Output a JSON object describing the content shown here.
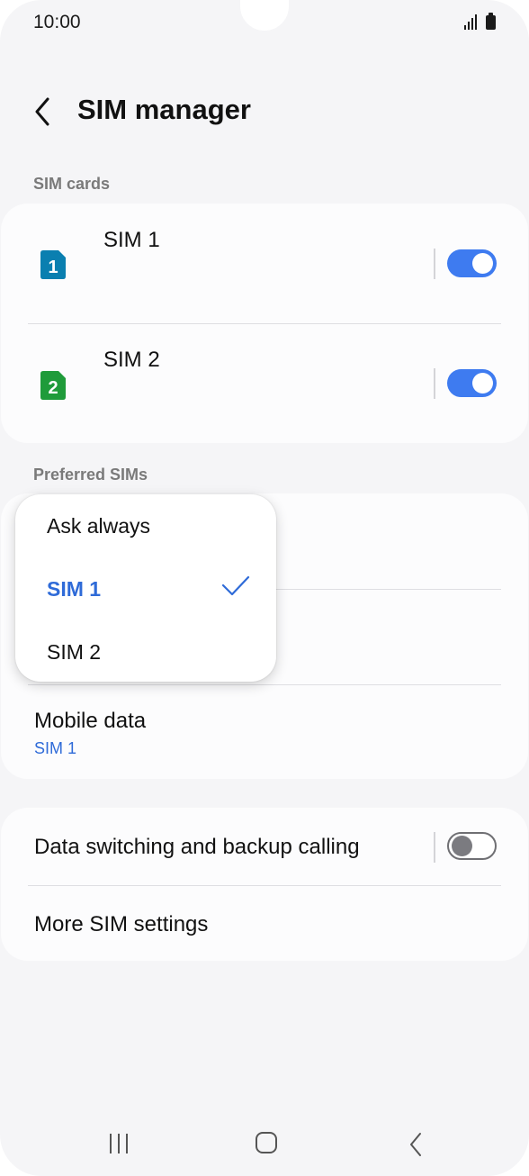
{
  "status_bar": {
    "time": "10:00",
    "icons": [
      "signal-icon",
      "battery-icon"
    ]
  },
  "header": {
    "back_icon": "chevron-left-icon",
    "title": "SIM manager"
  },
  "sim_cards": {
    "section_label": "SIM cards",
    "items": [
      {
        "label": "SIM 1",
        "badge": "1",
        "color": "#0a7fb0",
        "enabled": true
      },
      {
        "label": "SIM 2",
        "badge": "2",
        "color": "#1f9b3a",
        "enabled": true
      }
    ]
  },
  "preferred": {
    "section_label": "Preferred SIMs",
    "mobile_data": {
      "title": "Mobile data",
      "value": "SIM 1"
    }
  },
  "popup_menu": {
    "options": [
      "Ask always",
      "SIM 1",
      "SIM 2"
    ],
    "selected": "SIM 1"
  },
  "more": {
    "data_switching": {
      "label": "Data switching and backup calling",
      "enabled": false
    },
    "more_sim_settings": "More SIM settings"
  },
  "colors": {
    "accent": "#3e7bf0",
    "link": "#2f6bd8",
    "background": "#f5f5f7",
    "card": "#fcfcfd"
  },
  "nav_bar": {
    "icons": [
      "recents-icon",
      "home-icon",
      "back-icon"
    ]
  }
}
